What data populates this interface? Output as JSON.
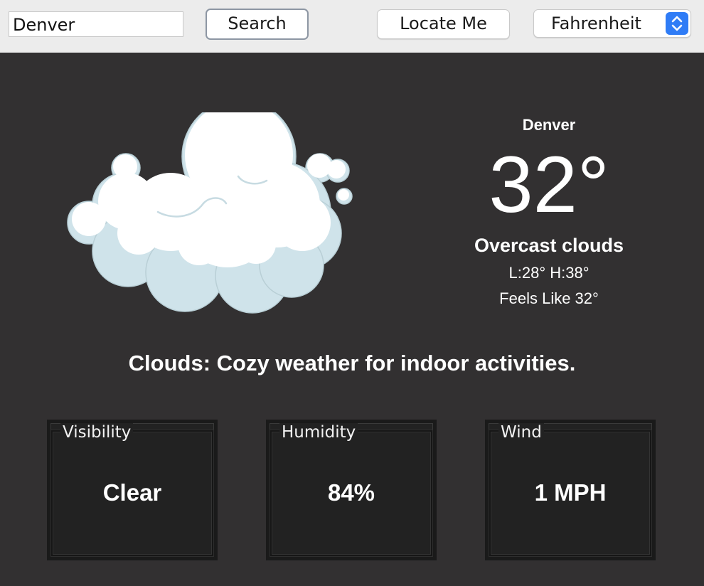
{
  "toolbar": {
    "search_value": "Denver",
    "search_button": "Search",
    "locate_button": "Locate Me",
    "unit_selected": "Fahrenheit"
  },
  "current": {
    "icon": "overcast-cloud-icon",
    "city": "Denver",
    "temperature": "32°",
    "condition": "Overcast clouds",
    "low_high": "L:28° H:38°",
    "feels_like": "Feels Like 32°"
  },
  "tagline": "Clouds: Cozy weather for indoor activities.",
  "cards": [
    {
      "title": "Visibility",
      "value": "Clear"
    },
    {
      "title": "Humidity",
      "value": "84%"
    },
    {
      "title": "Wind",
      "value": "1 MPH"
    }
  ],
  "colors": {
    "background": "#323031",
    "toolbar": "#ececec",
    "accent": "#2f7cf6",
    "card": "#222222",
    "cloud": "#ffffff",
    "cloud_shadow": "#cfe3ea"
  }
}
